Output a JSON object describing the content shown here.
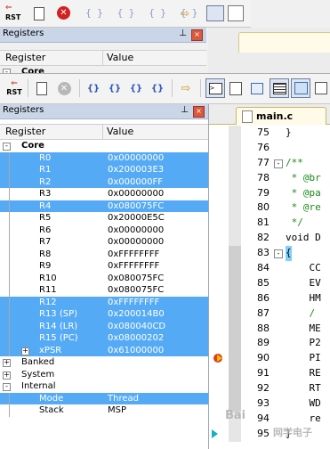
{
  "back_window": {
    "panel_title": "Registers",
    "col_register": "Register",
    "col_value": "Value",
    "first_row": "Core"
  },
  "toolbar": {
    "rst_label": "RST",
    "buttons": [
      "{}",
      "{}",
      "{}",
      "{}"
    ]
  },
  "registers_panel": {
    "title": "Registers",
    "pin": "2",
    "close": "×",
    "col_register": "Register",
    "col_value": "Value"
  },
  "registers": [
    {
      "name": "Core",
      "value": "",
      "level": 0,
      "toggle": "-",
      "selected": false
    },
    {
      "name": "R0",
      "value": "0x00000000",
      "level": 1,
      "selected": true
    },
    {
      "name": "R1",
      "value": "0x200003E3",
      "level": 1,
      "selected": true
    },
    {
      "name": "R2",
      "value": "0x000000FF",
      "level": 1,
      "selected": true
    },
    {
      "name": "R3",
      "value": "0x00000000",
      "level": 1,
      "selected": false
    },
    {
      "name": "R4",
      "value": "0x080075FC",
      "level": 1,
      "selected": true
    },
    {
      "name": "R5",
      "value": "0x20000E5C",
      "level": 1,
      "selected": false
    },
    {
      "name": "R6",
      "value": "0x00000000",
      "level": 1,
      "selected": false
    },
    {
      "name": "R7",
      "value": "0x00000000",
      "level": 1,
      "selected": false
    },
    {
      "name": "R8",
      "value": "0xFFFFFFFF",
      "level": 1,
      "selected": false
    },
    {
      "name": "R9",
      "value": "0xFFFFFFFF",
      "level": 1,
      "selected": false
    },
    {
      "name": "R10",
      "value": "0x080075FC",
      "level": 1,
      "selected": false
    },
    {
      "name": "R11",
      "value": "0x080075FC",
      "level": 1,
      "selected": false
    },
    {
      "name": "R12",
      "value": "0xFFFFFFFF",
      "level": 1,
      "selected": true
    },
    {
      "name": "R13 (SP)",
      "value": "0x200014B0",
      "level": 1,
      "selected": true
    },
    {
      "name": "R14 (LR)",
      "value": "0x080040CD",
      "level": 1,
      "selected": true
    },
    {
      "name": "R15 (PC)",
      "value": "0x08000202",
      "level": 1,
      "selected": true
    },
    {
      "name": "xPSR",
      "value": "0x61000000",
      "level": 1,
      "toggle": "+",
      "selected": true
    },
    {
      "name": "Banked",
      "value": "",
      "level": 0,
      "toggle": "+",
      "selected": false
    },
    {
      "name": "System",
      "value": "",
      "level": 0,
      "toggle": "+",
      "selected": false
    },
    {
      "name": "Internal",
      "value": "",
      "level": 0,
      "toggle": "-",
      "selected": false
    },
    {
      "name": "Mode",
      "value": "Thread",
      "level": 1,
      "selected": true
    },
    {
      "name": "Stack",
      "value": "MSP",
      "level": 1,
      "selected": false
    }
  ],
  "editor": {
    "tab_label": "main.c",
    "lines": [
      {
        "num": "75",
        "code": "}",
        "fold": "",
        "cls": "kw"
      },
      {
        "num": "76",
        "code": "",
        "fold": "",
        "cls": "kw"
      },
      {
        "num": "77",
        "code": "/**",
        "fold": "-",
        "cls": "cmt"
      },
      {
        "num": "78",
        "code": " * @br",
        "fold": "",
        "cls": "cmt"
      },
      {
        "num": "79",
        "code": " * @pa",
        "fold": "",
        "cls": "cmt"
      },
      {
        "num": "80",
        "code": " * @re",
        "fold": "",
        "cls": "cmt"
      },
      {
        "num": "81",
        "code": " */",
        "fold": "",
        "cls": "cmt"
      },
      {
        "num": "82",
        "code": "void D",
        "fold": "",
        "cls": "kw"
      },
      {
        "num": "83",
        "code": "{",
        "fold": "-",
        "cls": "kw"
      },
      {
        "num": "84",
        "code": "    CC",
        "fold": "",
        "cls": "kw"
      },
      {
        "num": "85",
        "code": "    EV",
        "fold": "",
        "cls": "kw"
      },
      {
        "num": "86",
        "code": "    HM",
        "fold": "",
        "cls": "kw"
      },
      {
        "num": "87",
        "code": "    /",
        "fold": "",
        "cls": "cmt"
      },
      {
        "num": "88",
        "code": "    ME",
        "fold": "",
        "cls": "kw"
      },
      {
        "num": "89",
        "code": "    P2",
        "fold": "",
        "cls": "kw"
      },
      {
        "num": "90",
        "code": "    PI",
        "fold": "",
        "cls": "kw"
      },
      {
        "num": "91",
        "code": "    RE",
        "fold": "",
        "cls": "kw"
      },
      {
        "num": "92",
        "code": "    RT",
        "fold": "",
        "cls": "kw"
      },
      {
        "num": "93",
        "code": "    WD",
        "fold": "",
        "cls": "kw"
      },
      {
        "num": "94",
        "code": "    re",
        "fold": "",
        "cls": "kw"
      },
      {
        "num": "95",
        "code": "}",
        "fold": "",
        "cls": "kw"
      }
    ]
  },
  "watermark": {
    "baidu": "Bai",
    "site": "网学电子"
  }
}
